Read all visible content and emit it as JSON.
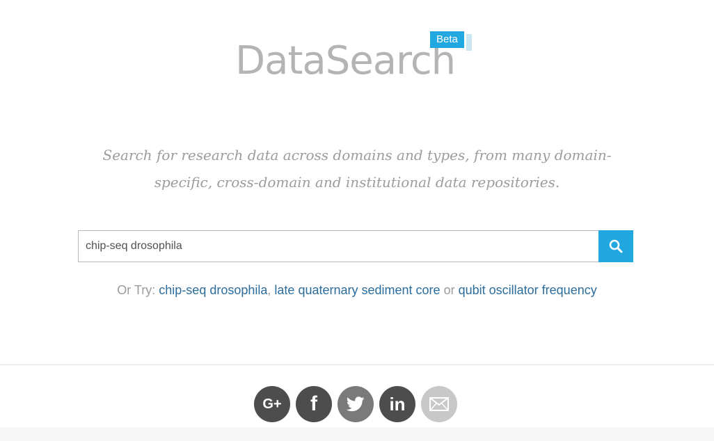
{
  "logo": {
    "text": "DataSearch",
    "badge": "Beta"
  },
  "tagline": "Search for research data across domains and types, from many domain-specific, cross-domain and institutional data repositories.",
  "search": {
    "value": "chip-seq drosophila",
    "button_icon": "search-icon"
  },
  "suggestions": {
    "prefix": "Or Try:",
    "links": [
      "chip-seq drosophila",
      "late quaternary sediment core",
      "qubit oscillator frequency"
    ],
    "separator_comma": ",",
    "separator_or": "or"
  },
  "footer": {
    "social": [
      {
        "name": "google-plus",
        "label": "G+"
      },
      {
        "name": "facebook",
        "label": "f"
      },
      {
        "name": "twitter",
        "label": ""
      },
      {
        "name": "linkedin",
        "label": "in"
      },
      {
        "name": "email",
        "label": ""
      }
    ]
  },
  "colors": {
    "accent": "#22a8e0",
    "link": "#2b6c9b",
    "muted_text": "#9b9b9b",
    "logo_gray": "#b4b4b4"
  }
}
